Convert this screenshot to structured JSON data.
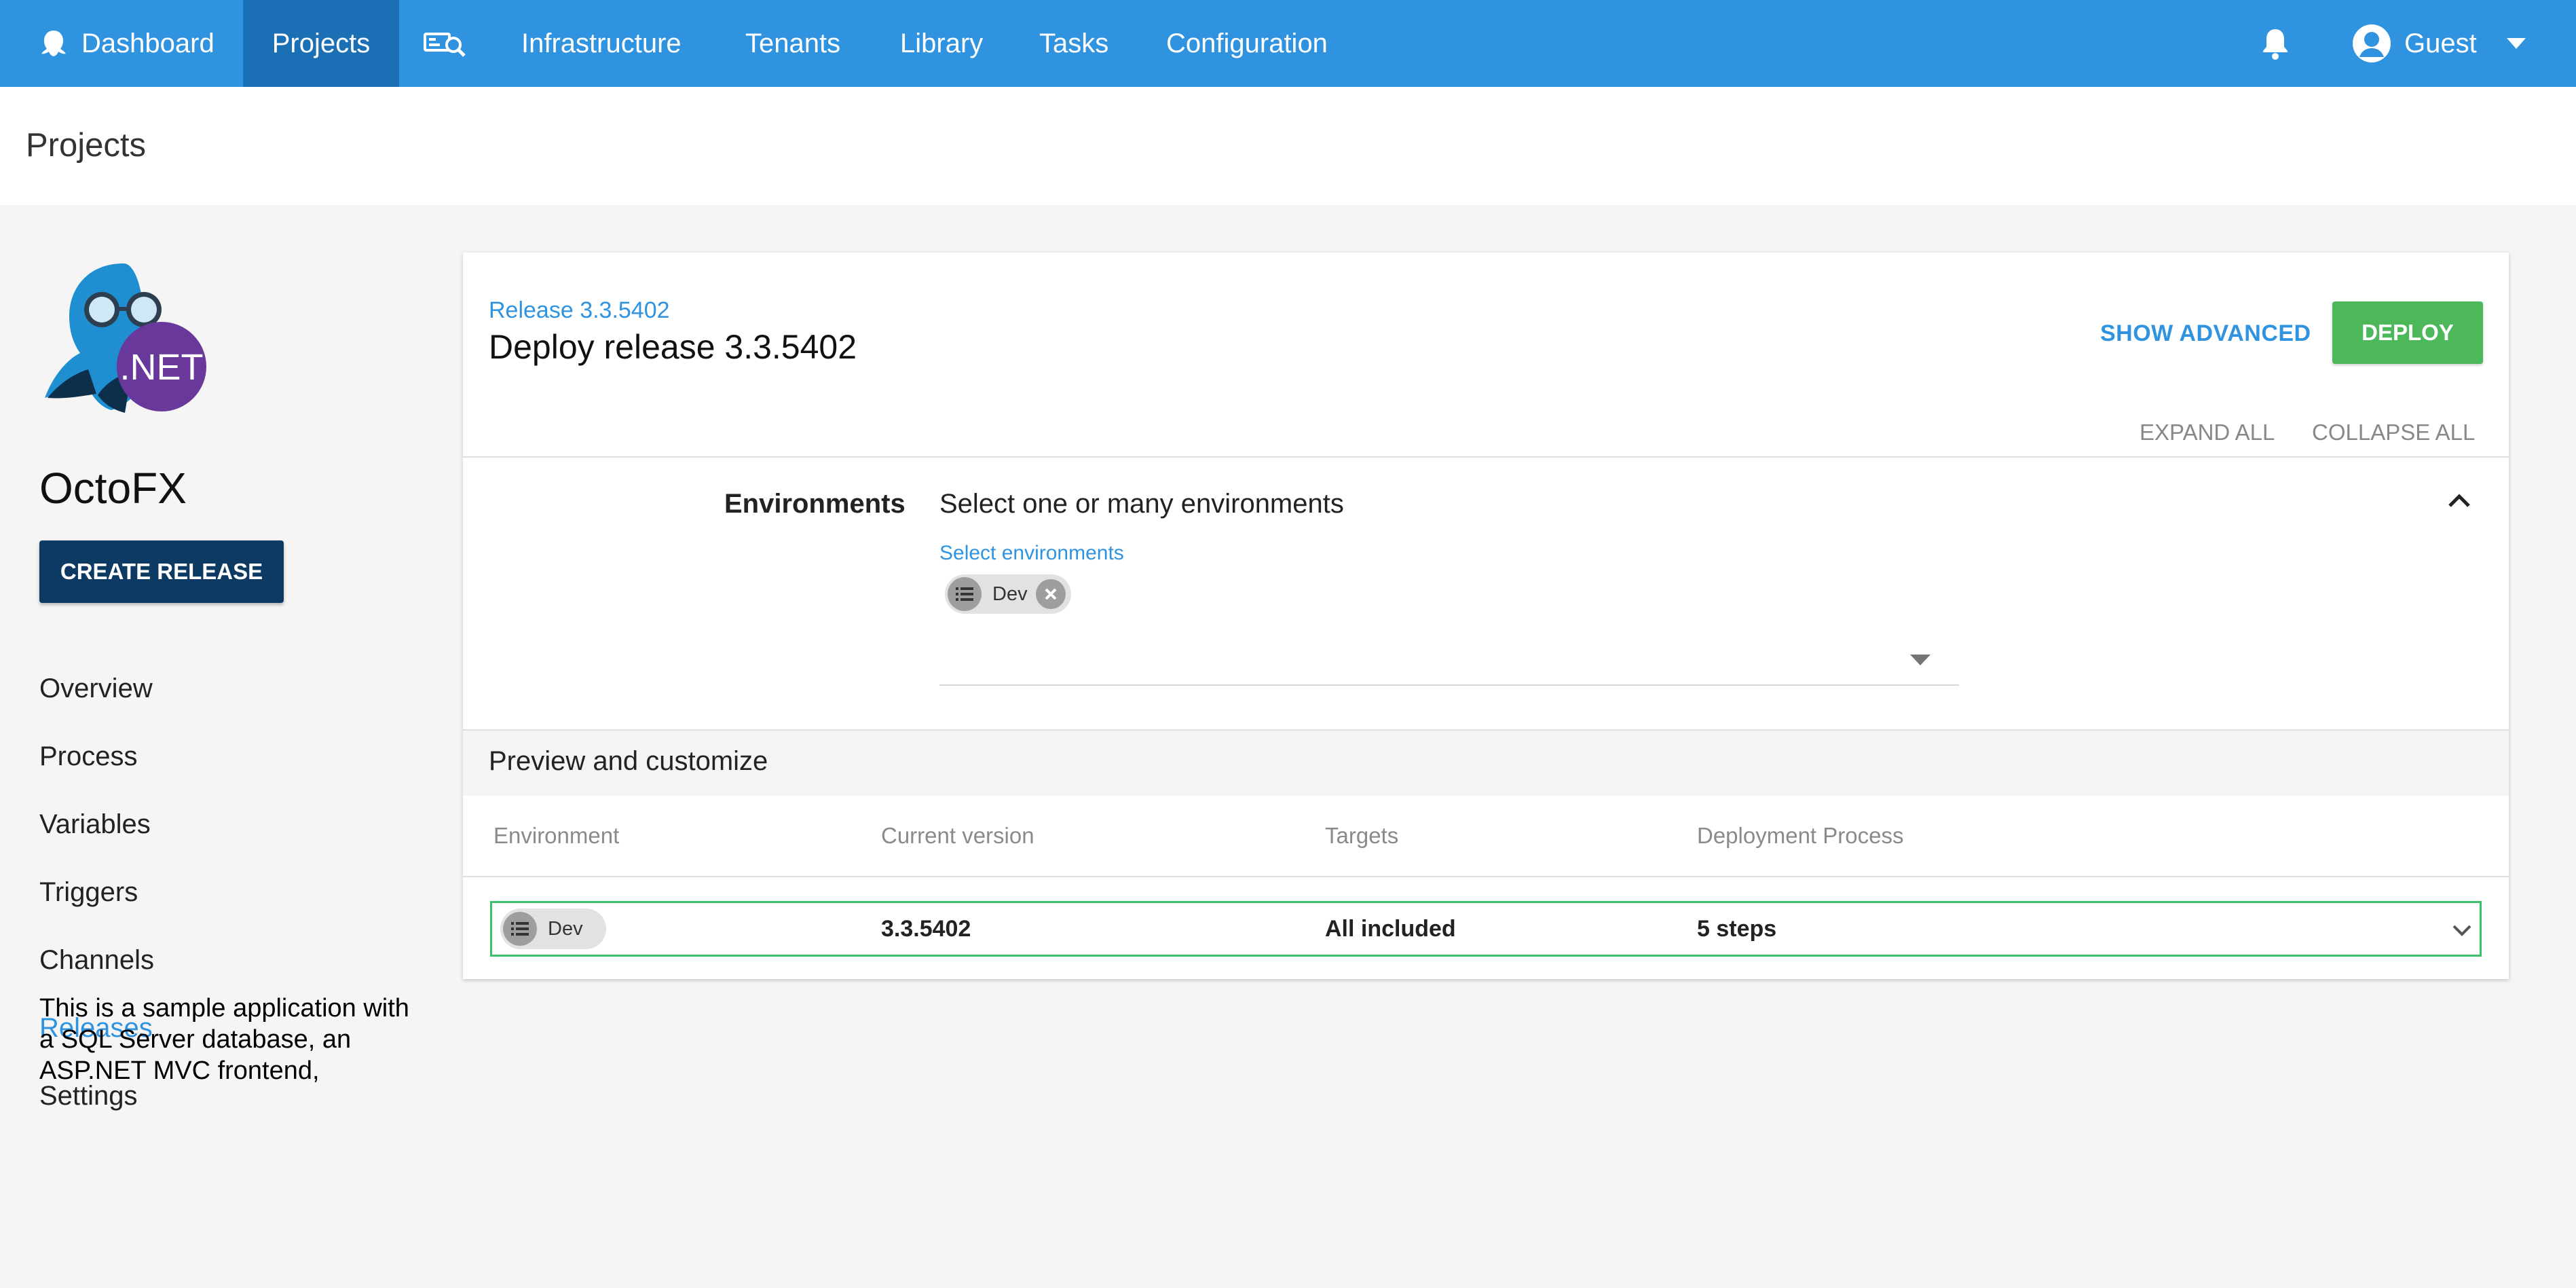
{
  "nav": {
    "dashboard": "Dashboard",
    "projects": "Projects",
    "infrastructure": "Infrastructure",
    "tenants": "Tenants",
    "library": "Library",
    "tasks": "Tasks",
    "configuration": "Configuration",
    "user": "Guest"
  },
  "page": {
    "title": "Projects"
  },
  "sidebar": {
    "project_name": "OctoFX",
    "create_release": "CREATE RELEASE",
    "links": [
      "Overview",
      "Process",
      "Variables",
      "Triggers",
      "Channels",
      "Releases",
      "Settings"
    ],
    "active": "Releases",
    "description": "This is a sample application with a SQL Server database, an ASP.NET MVC frontend,",
    "logo_text": ".NET"
  },
  "release": {
    "link": "Release 3.3.5402",
    "title": "Deploy release 3.3.5402",
    "show_advanced": "SHOW ADVANCED",
    "deploy": "DEPLOY",
    "expand_all": "EXPAND ALL",
    "collapse_all": "COLLAPSE ALL"
  },
  "environments": {
    "label": "Environments",
    "prompt": "Select one or many environments",
    "select_label": "Select environments",
    "selected": [
      "Dev"
    ]
  },
  "preview": {
    "title": "Preview and customize",
    "columns": [
      "Environment",
      "Current version",
      "Targets",
      "Deployment Process"
    ],
    "rows": [
      {
        "environment": "Dev",
        "current_version": "3.3.5402",
        "targets": "All included",
        "deployment_process": "5 steps"
      }
    ]
  },
  "colors": {
    "nav_bg": "#2f93e0",
    "nav_active": "#1a6fb5",
    "accent": "#2f93e0",
    "create_release_bg": "#0d3a62",
    "deploy_bg": "#4cb85a",
    "row_border": "#3cc26b"
  }
}
